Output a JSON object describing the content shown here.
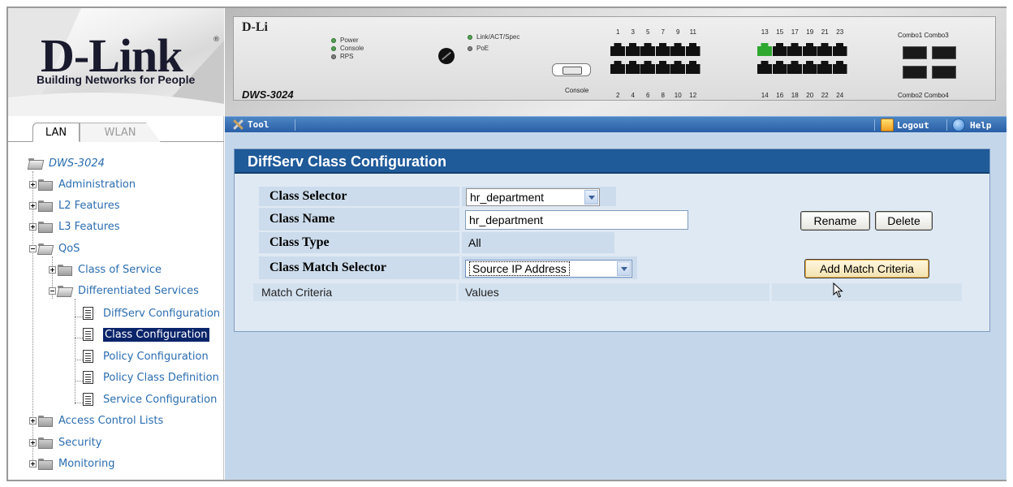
{
  "branding": {
    "logo_text": "D-Link",
    "registered_mark": "®",
    "tagline": "Building Networks for People"
  },
  "tabs": [
    {
      "label": "LAN",
      "active": true
    },
    {
      "label": "WLAN",
      "active": false
    }
  ],
  "tree": {
    "root": "DWS-3024",
    "items": [
      {
        "label": "Administration"
      },
      {
        "label": "L2 Features"
      },
      {
        "label": "L3 Features"
      },
      {
        "label": "QoS"
      },
      {
        "label": "Class of Service"
      },
      {
        "label": "Differentiated Services"
      },
      {
        "label": "DiffServ Configuration"
      },
      {
        "label": "Class Configuration",
        "selected": true
      },
      {
        "label": "Policy Configuration"
      },
      {
        "label": "Policy Class Definition"
      },
      {
        "label": "Service Configuration"
      },
      {
        "label": "Access Control Lists"
      },
      {
        "label": "Security"
      },
      {
        "label": "Monitoring"
      }
    ]
  },
  "device": {
    "logo": "D-Li",
    "model": "DWS-3024",
    "leds_left": [
      "Power",
      "Console",
      "RPS"
    ],
    "leds_right": [
      "Link/ACT/Spec",
      "PoE"
    ],
    "console_label": "Console",
    "ports_top_a": [
      "1",
      "3",
      "5",
      "7",
      "9",
      "11"
    ],
    "ports_bottom_a": [
      "2",
      "4",
      "6",
      "8",
      "10",
      "12"
    ],
    "ports_top_b": [
      "13",
      "15",
      "17",
      "19",
      "21",
      "23"
    ],
    "ports_bottom_b": [
      "14",
      "16",
      "18",
      "20",
      "22",
      "24"
    ],
    "combo_top": "Combo1 Combo3",
    "combo_bottom": "Combo2 Combo4",
    "lit_port": "13"
  },
  "toolbar": {
    "tool_label": "Tool",
    "logout_label": "Logout",
    "help_label": "Help"
  },
  "panel": {
    "title": "DiffServ Class Configuration",
    "class_selector_label": "Class Selector",
    "class_selector_value": "hr_department",
    "class_name_label": "Class Name",
    "class_name_value": "hr_department",
    "class_type_label": "Class Type",
    "class_type_value": "All",
    "class_match_selector_label": "Class Match Selector",
    "class_match_selector_value": "Source IP Address",
    "rename_button": "Rename",
    "delete_button": "Delete",
    "add_match_button": "Add Match Criteria",
    "match_criteria_header": "Match Criteria",
    "values_header": "Values"
  },
  "colors": {
    "toolbar": "#2f66ab",
    "panel_header": "#1f5a99",
    "content_bg": "#c4d7ea",
    "tree_link": "#2a6db0",
    "selected": "#0a246a"
  }
}
